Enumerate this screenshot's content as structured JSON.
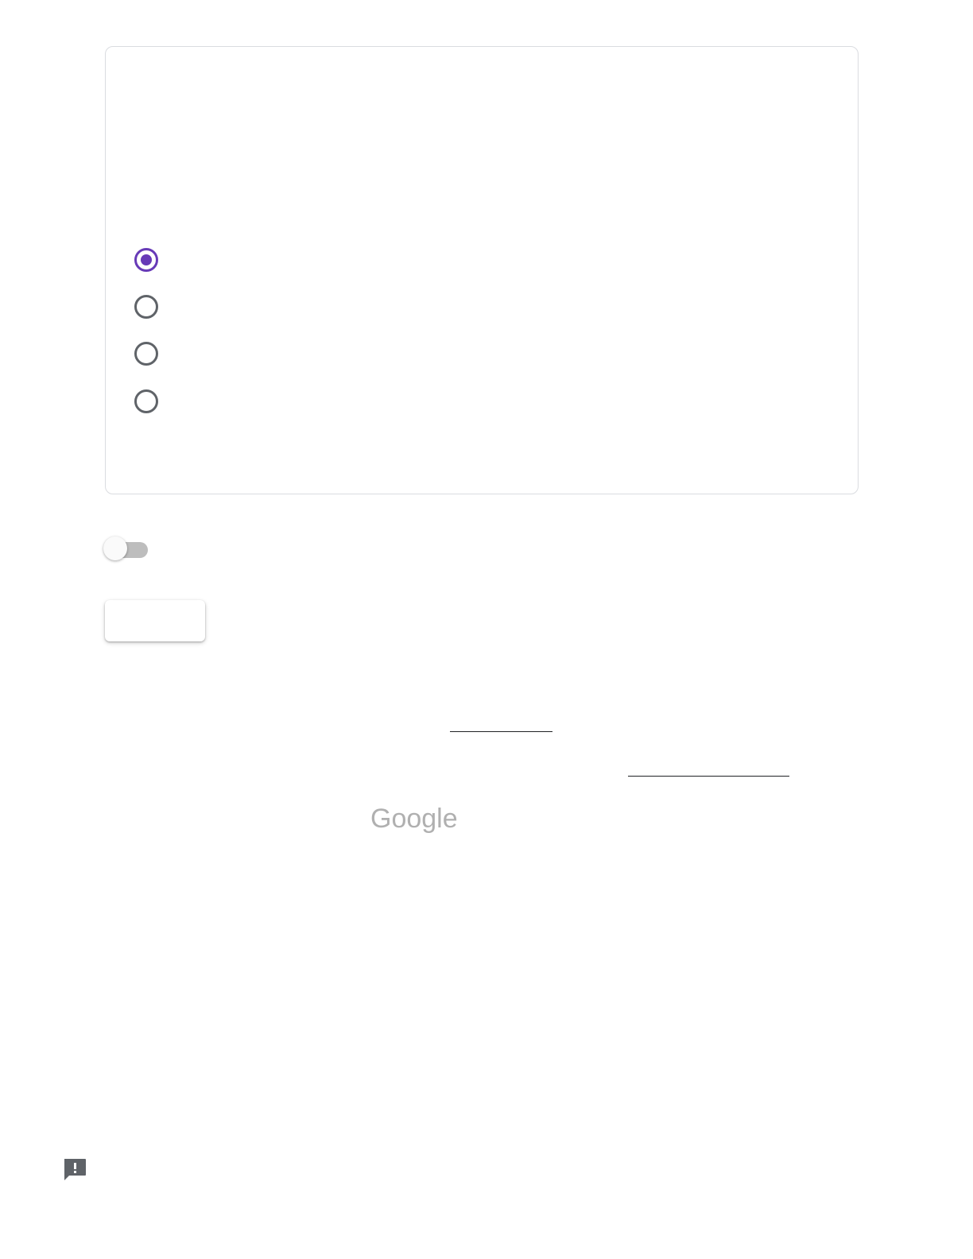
{
  "question": {
    "title": "",
    "options": [
      {
        "label": "",
        "checked": true
      },
      {
        "label": "",
        "checked": false
      },
      {
        "label": "",
        "checked": false
      },
      {
        "label": "",
        "checked": false
      }
    ]
  },
  "toggle": {
    "label": "",
    "on": false
  },
  "form_actions": {
    "submit_label": ""
  },
  "footer": {
    "line1": "",
    "link1": "",
    "line2": "",
    "link2": "",
    "brand": "Google"
  },
  "icons": {
    "feedback": "feedback-icon",
    "radio_checked": "radio-checked-icon",
    "radio_unchecked": "radio-unchecked-icon"
  },
  "colors": {
    "accent": "#673ab7",
    "radio_unchecked": "#5f6368",
    "card_border": "#dadce0",
    "toggle_track": "#bdbdbd",
    "logo_gray": "#b0b0b0",
    "feedback_icon": "#5f6368"
  }
}
